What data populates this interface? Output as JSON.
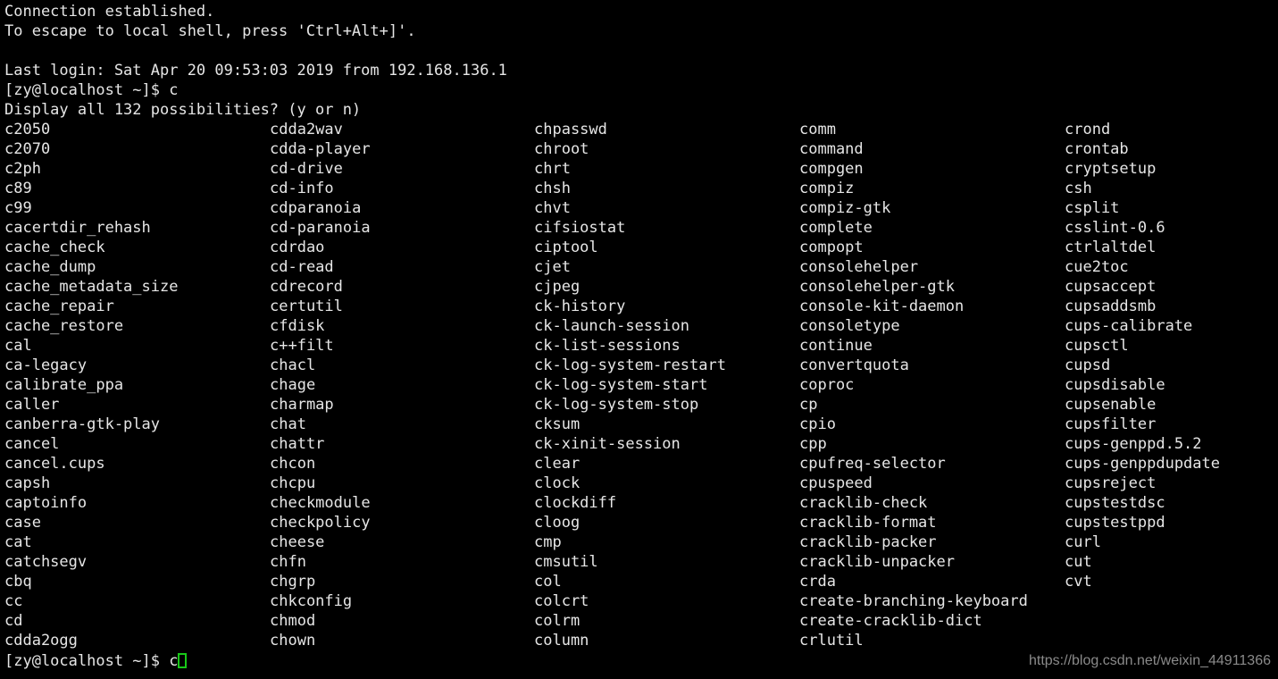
{
  "terminal": {
    "colors": {
      "background": "#000000",
      "foreground": "#e6e6e6",
      "cursor_outline": "#18c818",
      "watermark": "#8a8a8a"
    },
    "header_lines": [
      "Connection established.",
      "To escape to local shell, press 'Ctrl+Alt+]'.",
      "",
      "Last login: Sat Apr 20 09:53:03 2019 from 192.168.136.1"
    ],
    "connection_message": "Connection established.",
    "escape_message": "To escape to local shell, press 'Ctrl+Alt+]'.",
    "last_login": "Last login: Sat Apr 20 09:53:03 2019 from 192.168.136.1",
    "prompt": "[zy@localhost ~]$ ",
    "typed_command": "c",
    "prompt_line_top": "[zy@localhost ~]$ c",
    "completion_query": "Display all 132 possibilities? (y or n)",
    "possibilities_count": "132",
    "bottom_prompt": "[zy@localhost ~]$ ",
    "bottom_typed": "c",
    "watermark": "https://blog.csdn.net/weixin_44911366"
  },
  "completions": {
    "columns": [
      [
        "c2050",
        "c2070",
        "c2ph",
        "c89",
        "c99",
        "cacertdir_rehash",
        "cache_check",
        "cache_dump",
        "cache_metadata_size",
        "cache_repair",
        "cache_restore",
        "cal",
        "ca-legacy",
        "calibrate_ppa",
        "caller",
        "canberra-gtk-play",
        "cancel",
        "cancel.cups",
        "capsh",
        "captoinfo",
        "case",
        "cat",
        "catchsegv",
        "cbq",
        "cc",
        "cd",
        "cdda2ogg"
      ],
      [
        "cdda2wav",
        "cdda-player",
        "cd-drive",
        "cd-info",
        "cdparanoia",
        "cd-paranoia",
        "cdrdao",
        "cd-read",
        "cdrecord",
        "certutil",
        "cfdisk",
        "c++filt",
        "chacl",
        "chage",
        "charmap",
        "chat",
        "chattr",
        "chcon",
        "chcpu",
        "checkmodule",
        "checkpolicy",
        "cheese",
        "chfn",
        "chgrp",
        "chkconfig",
        "chmod",
        "chown"
      ],
      [
        "chpasswd",
        "chroot",
        "chrt",
        "chsh",
        "chvt",
        "cifsiostat",
        "ciptool",
        "cjet",
        "cjpeg",
        "ck-history",
        "ck-launch-session",
        "ck-list-sessions",
        "ck-log-system-restart",
        "ck-log-system-start",
        "ck-log-system-stop",
        "cksum",
        "ck-xinit-session",
        "clear",
        "clock",
        "clockdiff",
        "cloog",
        "cmp",
        "cmsutil",
        "col",
        "colcrt",
        "colrm",
        "column"
      ],
      [
        "comm",
        "command",
        "compgen",
        "compiz",
        "compiz-gtk",
        "complete",
        "compopt",
        "consolehelper",
        "consolehelper-gtk",
        "console-kit-daemon",
        "consoletype",
        "continue",
        "convertquota",
        "coproc",
        "cp",
        "cpio",
        "cpp",
        "cpufreq-selector",
        "cpuspeed",
        "cracklib-check",
        "cracklib-format",
        "cracklib-packer",
        "cracklib-unpacker",
        "crda",
        "create-branching-keyboard",
        "create-cracklib-dict",
        "crlutil"
      ],
      [
        "crond",
        "crontab",
        "cryptsetup",
        "csh",
        "csplit",
        "csslint-0.6",
        "ctrlaltdel",
        "cue2toc",
        "cupsaccept",
        "cupsaddsmb",
        "cups-calibrate",
        "cupsctl",
        "cupsd",
        "cupsdisable",
        "cupsenable",
        "cupsfilter",
        "cups-genppd.5.2",
        "cups-genppdupdate",
        "cupsreject",
        "cupstestdsc",
        "cupstestppd",
        "curl",
        "cut",
        "cvt"
      ]
    ]
  }
}
